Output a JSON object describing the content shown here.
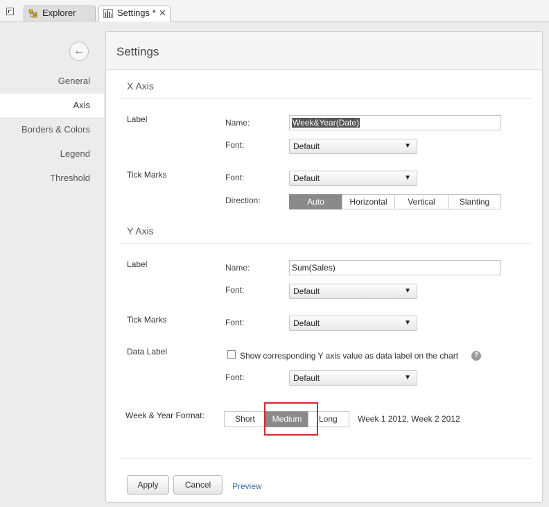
{
  "tabs": {
    "explorer_label": "Explorer",
    "settings_label": "Settings *",
    "close_glyph": "✕"
  },
  "sidebar": {
    "back_glyph": "←",
    "items": [
      {
        "label": "General"
      },
      {
        "label": "Axis",
        "active": true
      },
      {
        "label": "Borders & Colors"
      },
      {
        "label": "Legend"
      },
      {
        "label": "Threshold"
      }
    ]
  },
  "panel": {
    "title": "Settings"
  },
  "x_axis": {
    "title": "X Axis",
    "label_row": "Label",
    "name_label": "Name:",
    "name_value": "Week&Year(Date)",
    "font_label": "Font:",
    "font_value": "Default",
    "tick_row": "Tick Marks",
    "tick_font_label": "Font:",
    "tick_font_value": "Default",
    "direction_label": "Direction:",
    "direction_options": [
      "Auto",
      "Horizontal",
      "Vertical",
      "Slanting"
    ],
    "direction_selected": "Auto"
  },
  "y_axis": {
    "title": "Y Axis",
    "label_row": "Label",
    "name_label": "Name:",
    "name_value": "Sum(Sales)",
    "font_label": "Font:",
    "font_value": "Default",
    "tick_row": "Tick Marks",
    "tick_font_label": "Font:",
    "tick_font_value": "Default",
    "data_label_row": "Data Label",
    "data_label_checkbox": "Show corresponding Y axis value as data label on the chart",
    "data_label_checked": false,
    "help_glyph": "?",
    "data_font_label": "Font:",
    "data_font_value": "Default"
  },
  "week_format": {
    "label": "Week & Year Format:",
    "options": [
      "Short",
      "Medium",
      "Long"
    ],
    "selected": "Medium",
    "example": "Week 1 2012, Week 2 2012"
  },
  "footer": {
    "apply": "Apply",
    "cancel": "Cancel",
    "preview": "Preview"
  },
  "caret_glyph": "▼",
  "colors": {
    "highlight": "#d9262b",
    "active_segment": "#8a8a8a",
    "link": "#3a6ea5"
  }
}
